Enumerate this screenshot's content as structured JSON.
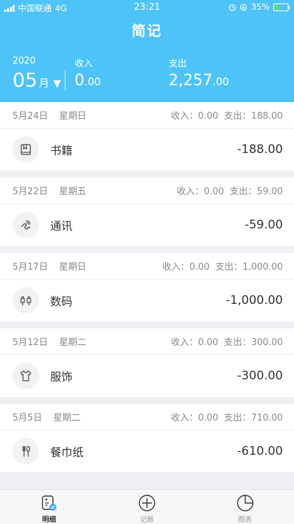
{
  "status": {
    "carrier": "中国联通",
    "network": "4G",
    "time": "23:21",
    "battery": "35%",
    "battery_level": 0.35
  },
  "app": {
    "title": "简记"
  },
  "summary": {
    "year": "2020",
    "month": "05",
    "month_unit": "月",
    "income_label": "收入",
    "income_int": "0",
    "income_dec": ".00",
    "expense_label": "支出",
    "expense_int": "2,257",
    "expense_dec": ".00"
  },
  "groups": [
    {
      "date": "5月24日",
      "weekday": "星期日",
      "income": "收入：0.00",
      "expense": "支出：188.00",
      "entries": [
        {
          "category": "书籍",
          "amount": "-188.00",
          "icon": "book-icon"
        }
      ]
    },
    {
      "date": "5月22日",
      "weekday": "星期五",
      "income": "收入：0.00",
      "expense": "支出：59.00",
      "entries": [
        {
          "category": "通讯",
          "amount": "-59.00",
          "icon": "phone-icon"
        }
      ]
    },
    {
      "date": "5月17日",
      "weekday": "星期日",
      "income": "收入：0.00",
      "expense": "支出：1,000.00",
      "entries": [
        {
          "category": "数码",
          "amount": "-1,000.00",
          "icon": "plug-icon"
        }
      ]
    },
    {
      "date": "5月12日",
      "weekday": "星期二",
      "income": "收入：0.00",
      "expense": "支出：300.00",
      "entries": [
        {
          "category": "服饰",
          "amount": "-300.00",
          "icon": "shirt-icon"
        }
      ]
    },
    {
      "date": "5月5日",
      "weekday": "星期二",
      "income": "收入：0.00",
      "expense": "支出：710.00",
      "entries": [
        {
          "category": "餐巾纸",
          "amount": "-610.00",
          "icon": "utensils-icon"
        }
      ]
    }
  ],
  "tabs": [
    {
      "label": "明细",
      "icon": "detail-icon",
      "active": true
    },
    {
      "label": "记账",
      "icon": "add-icon",
      "active": false
    },
    {
      "label": "图表",
      "icon": "pie-chart-icon",
      "active": false
    }
  ],
  "colors": {
    "header": "#4ec3f7",
    "battery": "#7ed957"
  }
}
